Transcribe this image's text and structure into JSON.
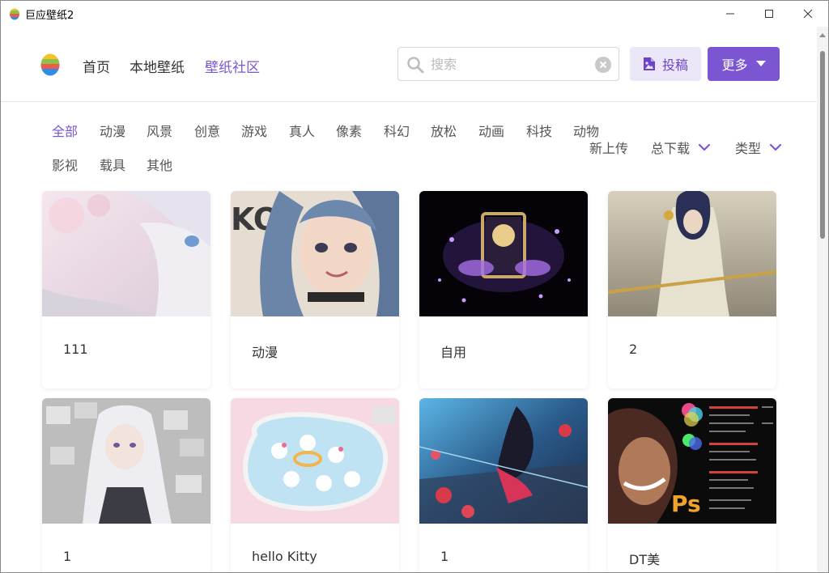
{
  "window": {
    "title": "巨应壁纸2"
  },
  "nav": {
    "home": "首页",
    "local": "本地壁纸",
    "community": "壁纸社区"
  },
  "search": {
    "placeholder": "搜索"
  },
  "actions": {
    "upload": "投稿",
    "more": "更多"
  },
  "categories": [
    "全部",
    "动漫",
    "风景",
    "创意",
    "游戏",
    "真人",
    "像素",
    "科幻",
    "放松",
    "动画",
    "科技",
    "动物",
    "影视",
    "载具",
    "其他"
  ],
  "sort": {
    "new": "新上传",
    "downloads": "总下载",
    "type": "类型"
  },
  "cards": [
    {
      "label": "111",
      "thumb": "anime-girl-white-hair-icon"
    },
    {
      "label": "动漫",
      "thumb": "anime-girl-blue-hair-icon"
    },
    {
      "label": "自用",
      "thumb": "purple-frame-portrait-icon"
    },
    {
      "label": "2",
      "thumb": "warrior-woman-spear-icon"
    },
    {
      "label": "1",
      "thumb": "white-hair-girl-papers-icon"
    },
    {
      "label": "hello Kitty",
      "thumb": "hello-kitty-pool-icon"
    },
    {
      "label": "1",
      "thumb": "anime-girl-action-icon"
    },
    {
      "label": "DT美",
      "thumb": "photoshop-woman-icon"
    }
  ],
  "colors": {
    "accent": "#7c55d3",
    "accent_light": "#ece7f8"
  }
}
